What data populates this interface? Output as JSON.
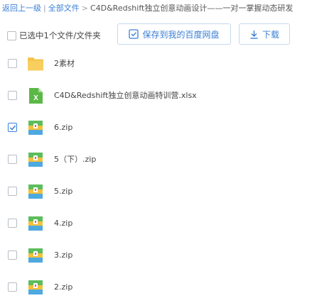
{
  "breadcrumb": {
    "back": "返回上一级",
    "all_files": "全部文件",
    "separator": ">",
    "current": "C4D&Redshift独立创意动画设计——一对一掌握动态研发"
  },
  "toolbar": {
    "select_all_label": "已选中1个文件/文件夹",
    "save_label": "保存到我的百度网盘",
    "download_label": "下载"
  },
  "colors": {
    "link": "#3a7fd5",
    "folder": "#f5c44c",
    "excel": "#5bb846"
  },
  "files": [
    {
      "name": "2素材",
      "icon": "folder-icon",
      "checked": false
    },
    {
      "name": "C4D&Redshift独立创意动画特训营.xlsx",
      "icon": "excel-icon",
      "checked": false
    },
    {
      "name": "6.zip",
      "icon": "zip-icon",
      "checked": true
    },
    {
      "name": "5（下）.zip",
      "icon": "zip-icon",
      "checked": false
    },
    {
      "name": "5.zip",
      "icon": "zip-icon",
      "checked": false
    },
    {
      "name": "4.zip",
      "icon": "zip-icon",
      "checked": false
    },
    {
      "name": "3.zip",
      "icon": "zip-icon",
      "checked": false
    },
    {
      "name": "2.zip",
      "icon": "zip-icon",
      "checked": false
    }
  ]
}
